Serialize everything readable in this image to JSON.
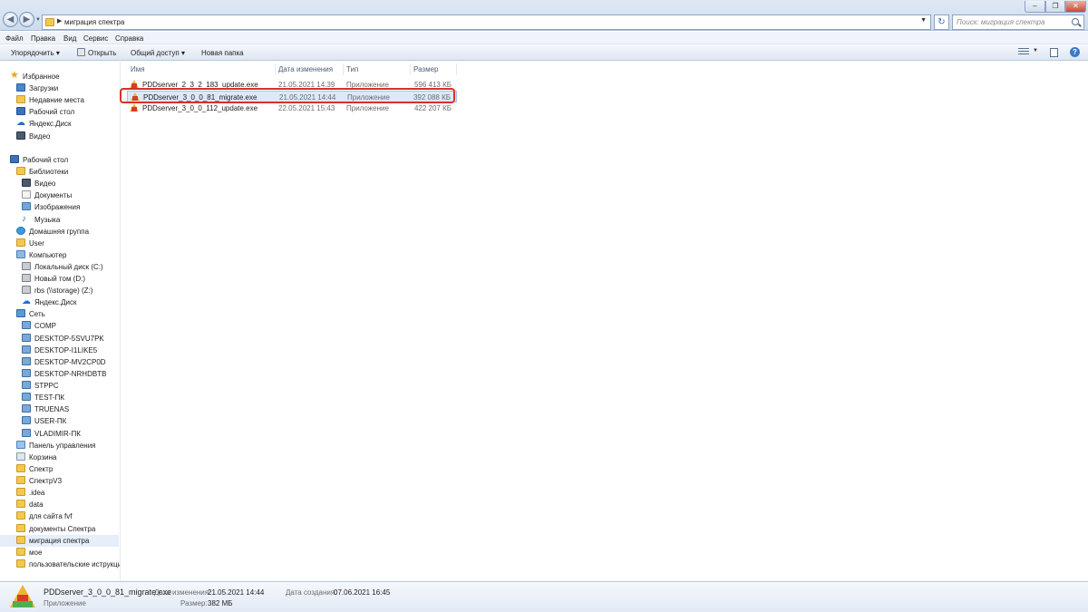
{
  "window": {
    "address_path": "миграция спектра",
    "search_placeholder": "Поиск: миграция спектра",
    "min_glyph": "–",
    "max_glyph": "❐",
    "close_glyph": "✕",
    "back_glyph": "◀",
    "fwd_glyph": "▶",
    "refresh_glyph": "↻",
    "help_glyph": "?"
  },
  "menu": [
    "Файл",
    "Правка",
    "Вид",
    "Сервис",
    "Справка"
  ],
  "toolbar": {
    "organize": "Упорядочить ▾",
    "open": "Открыть",
    "share": "Общий доступ ▾",
    "new_folder": "Новая папка"
  },
  "columns": {
    "name": "Имя",
    "date": "Дата изменения",
    "type": "Тип",
    "size": "Размер"
  },
  "files": [
    {
      "name": "PDDserver_2_3_2_183_update.exe",
      "date": "21.05.2021 14:39",
      "type": "Приложение",
      "size": "596 413 КБ"
    },
    {
      "name": "PDDserver_3_0_0_81_migrate.exe",
      "date": "21.05.2021 14:44",
      "type": "Приложение",
      "size": "392 088 КБ",
      "selected": true
    },
    {
      "name": "PDDserver_3_0_0_112_update.exe",
      "date": "22.05.2021 15:43",
      "type": "Приложение",
      "size": "422 207 КБ"
    }
  ],
  "nav": [
    {
      "label": "Избранное",
      "icon": "star-icon"
    },
    {
      "label": "Загрузки",
      "icon": "downloads-icon"
    },
    {
      "label": "Недавние места",
      "icon": "recent-places-icon"
    },
    {
      "label": "Рабочий стол",
      "icon": "desktop-icon"
    },
    {
      "label": "Яндекс.Диск",
      "icon": "yandex-disk-icon"
    },
    {
      "label": "Видео",
      "icon": "video-icon"
    },
    {
      "label": "Рабочий стол",
      "icon": "desktop-icon"
    },
    {
      "label": "Библиотеки",
      "icon": "libraries-icon"
    },
    {
      "label": "Видео",
      "icon": "video-icon"
    },
    {
      "label": "Документы",
      "icon": "documents-icon"
    },
    {
      "label": "Изображения",
      "icon": "images-icon"
    },
    {
      "label": "Музыка",
      "icon": "music-icon"
    },
    {
      "label": "Домашняя группа",
      "icon": "homegroup-icon"
    },
    {
      "label": "User",
      "icon": "user-folder-icon"
    },
    {
      "label": "Компьютер",
      "icon": "computer-icon"
    },
    {
      "label": "Локальный диск (C:)",
      "icon": "drive-icon"
    },
    {
      "label": "Новый том (D:)",
      "icon": "drive-icon"
    },
    {
      "label": "rbs (\\\\storage) (Z:)",
      "icon": "network-drive-icon"
    },
    {
      "label": "Яндекс.Диск",
      "icon": "yandex-disk-icon"
    },
    {
      "label": "Сеть",
      "icon": "network-icon"
    },
    {
      "label": "COMP",
      "icon": "network-computer-icon"
    },
    {
      "label": "DESKTOP-5SVU7PK",
      "icon": "network-computer-icon"
    },
    {
      "label": "DESKTOP-I1LIKE5",
      "icon": "network-computer-icon"
    },
    {
      "label": "DESKTOP-MV2CP0D",
      "icon": "network-computer-icon"
    },
    {
      "label": "DESKTOP-NRHDBTB",
      "icon": "network-computer-icon"
    },
    {
      "label": "STPPC",
      "icon": "network-computer-icon"
    },
    {
      "label": "TEST-ПК",
      "icon": "network-computer-icon"
    },
    {
      "label": "TRUENAS",
      "icon": "network-computer-icon"
    },
    {
      "label": "USER-ПК",
      "icon": "network-computer-icon"
    },
    {
      "label": "VLADIMIR-ПК",
      "icon": "network-computer-icon"
    },
    {
      "label": "Панель управления",
      "icon": "control-panel-icon"
    },
    {
      "label": "Корзина",
      "icon": "recycle-bin-icon"
    },
    {
      "label": "Спектр",
      "icon": "folder-icon"
    },
    {
      "label": "СпектрV3",
      "icon": "folder-icon"
    },
    {
      "label": ".idea",
      "icon": "folder-icon"
    },
    {
      "label": "data",
      "icon": "folder-icon"
    },
    {
      "label": "для сайта fvf",
      "icon": "folder-icon"
    },
    {
      "label": "документы Спектра",
      "icon": "folder-icon"
    },
    {
      "label": "миграция спектра",
      "icon": "folder-icon",
      "selected": true
    },
    {
      "label": "мое",
      "icon": "folder-icon"
    },
    {
      "label": "пользовательские иструкции",
      "icon": "folder-icon"
    }
  ],
  "details": {
    "filename": "PDDserver_3_0_0_81_migrate.exe",
    "type": "Приложение",
    "modified_label": "Дата изменения:",
    "modified_value": "21.05.2021 14:44",
    "size_label": "Размер:",
    "size_value": "382 МБ",
    "created_label": "Дата создания:",
    "created_value": "07.06.2021 16:45"
  },
  "colors": {
    "highlight": "#d9302a",
    "selection": "#dbe9f9"
  }
}
